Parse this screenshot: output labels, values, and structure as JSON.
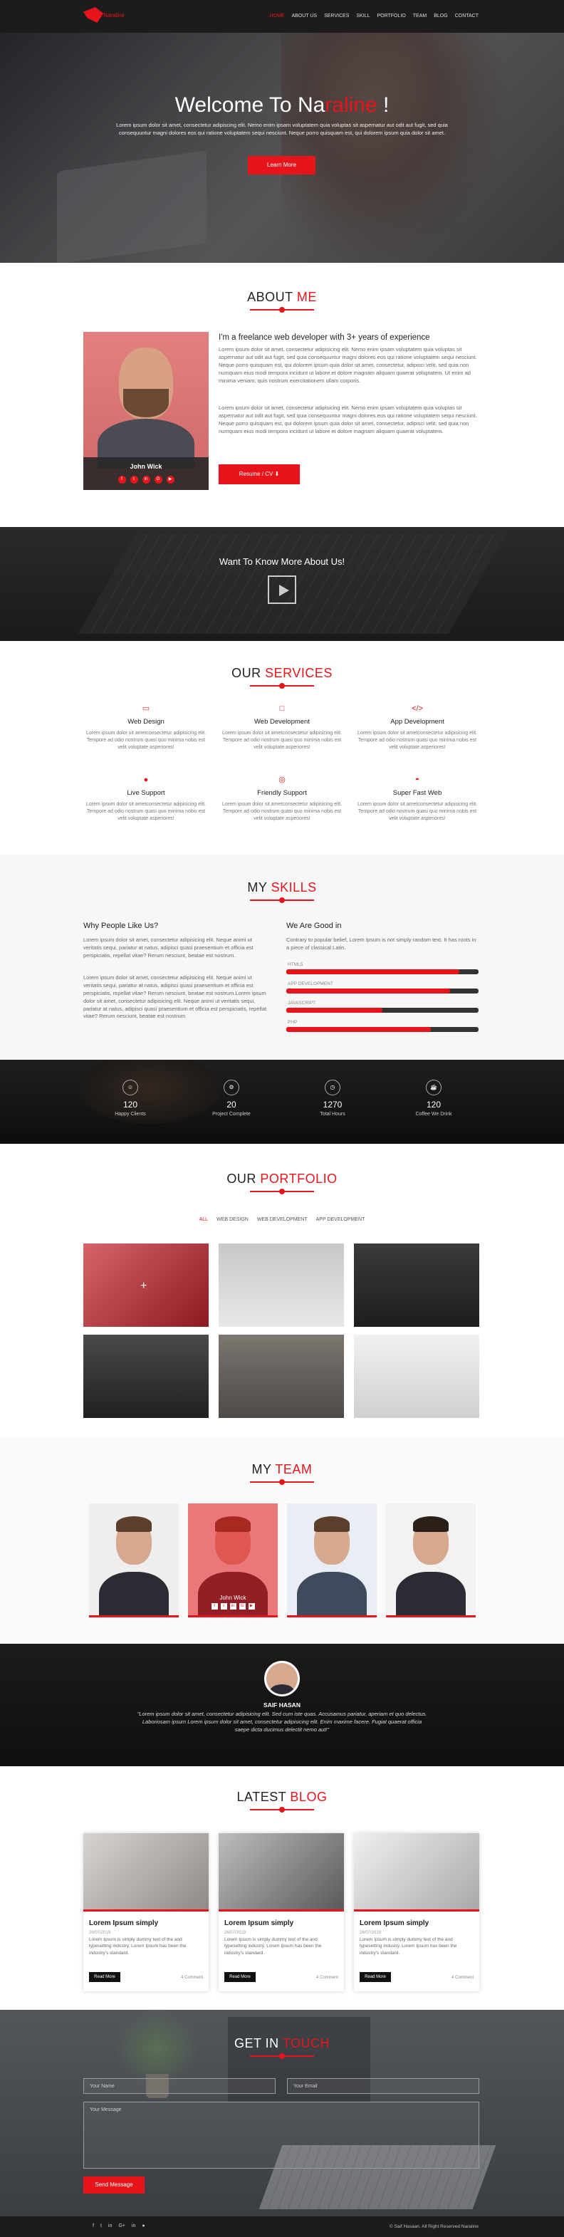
{
  "nav": {
    "logo_text": "Naraline",
    "items": [
      "HOME",
      "ABOUT US",
      "SERVICES",
      "SKILL",
      "PORTFOLIO",
      "TEAM",
      "BLOG",
      "CONTACT"
    ]
  },
  "hero": {
    "title_pre": "Welc",
    "title_mid1": "ome To Na",
    "title_red": "raline",
    "title_post": " !",
    "text": "Lorem ipsum dolor sit amet, consectetur adipiscing elit. Nemo enim ipsam voluptatem quia voluptas sit aspernatur aut odit aut fugit, sed quia consequuntur magni dolores eos qui ratione voluptatem sequi nesciunt. Neque porro quisquam est, qui dolorem ipsum quia dolor sit amet.",
    "button": "Learn More"
  },
  "about": {
    "title_a": "About",
    "title_b": "Me",
    "name": "John Wick",
    "heading": "I'm a freelance web developer with 3+ years of experience",
    "p1": "Lorem ipsum dolor sit amet, consectetur adipisicing elit. Nemo enim ipsam voluptatem quia voluptas sit aspernatur aut odit aut fugit, sed quia consequuntur magni dolores eos qui ratione voluptatem sequi nesciunt. Neque porro quisquam est, qui dolorem ipsum quia dolor sit amet, consectetur, adipisci velit, sed quia non numquam eius modi tempora incidunt ut labore et dolore magnam aliquam quaerat voluptatem. Ut enim ad minima veniam, quis nostrum exercitationem ullam corporis.",
    "p2": "Lorem ipsum dolor sit amet, consectetur adipisicing elit. Nemo enim ipsam voluptatem quia voluptas sit aspernatur aut odit aut fugit, sed quia consequuntur magni dolores eos qui ratione voluptatem sequi nesciunt. Neque porro quisquam est, qui dolorem ipsum quia dolor sit amet, consectetur, adipisci velit, sed quia non numquam eius modi tempora incidunt ut labore et dolore magnam aliquam quaerat voluptatem.",
    "resume": "Resume / CV"
  },
  "video": {
    "title": "Want To Know More About Us!"
  },
  "services": {
    "title_a": "Our",
    "title_b": "Services",
    "items": [
      {
        "icon": "monitor-icon",
        "glyph": "▭",
        "title": "Web Design",
        "desc": "Lorem ipsum dolor sit ametconsectetur adipisicing elit. Tempore ad odio nostrum quasi quo minima nobis est velit voluptate asperiores!"
      },
      {
        "icon": "laptop-icon",
        "glyph": "□",
        "title": "Web Development",
        "desc": "Lorem ipsum dolor sit ametconsectetur adipisicing elit. Tempore ad odio nostrum quasi quo minima nobis est velit voluptate asperiores!"
      },
      {
        "icon": "code-icon",
        "glyph": "</>",
        "title": "App Development",
        "desc": "Lorem ipsum dolor sit ametconsectetur adipisicing elit. Tempore ad odio nostrum quasi quo minima nobis est velit voluptate asperiores!"
      },
      {
        "icon": "chat-icon",
        "glyph": "●",
        "title": "Live Support",
        "desc": "Lorem ipsum dolor sit ametconsectetur adipisicing elit. Tempore ad odio nostrum quasi quo minima nobis est velit voluptate asperiores!"
      },
      {
        "icon": "lifebuoy-icon",
        "glyph": "◎",
        "title": "Friendly Support",
        "desc": "Lorem ipsum dolor sit ametconsectetur adipisicing elit. Tempore ad odio nostrum quasi quo minima nobis est velit voluptate asperiores!"
      },
      {
        "icon": "dashboard-icon",
        "glyph": "◓",
        "title": "Super Fast Web",
        "desc": "Lorem ipsum dolor sit ametconsectetur adipisicing elit. Tempore ad odio nostrum quasi quo minima nobis est velit voluptate asperiores!"
      }
    ]
  },
  "skills": {
    "title_a": "My",
    "title_b": "Skills",
    "left_heading": "Why People Like Us?",
    "left_p1": "Lorem ipsum dolor sit amet, consectetur adipisicing elit. Neque animi ut veritatis sequi, pariatur at natus, adipisci quasi praesentium et officia est perspiciatis, repellat vitae? Rerum nesciunt, beatae est nostrum.",
    "left_p2": "Lorem ipsum dolor sit amet, consectetur adipisicing elit. Neque animi ut veritatis sequi, pariatur at natus, adipisci quasi praesentium et officia est perspiciatis, repellat vitae? Rerum nesciunt, beatae est nostrum.Lorem ipsum dolor sit amet, consectetur adipisicing elit. Neque animi ut veritatis sequi, pariatur at natus, adipisci quasi praesentium et officia est perspiciatis, repellat vitae? Rerum nesciunt, beatae est nostrum.",
    "right_heading": "We Are Good in",
    "right_p": "Contrary to popular belief, Lorem Ipsum is not simply random text. It has roots in a piece of classical Latin.",
    "bars": [
      {
        "label": "HTML5",
        "value": 0.9,
        "pct": "90%"
      },
      {
        "label": "APP DEVELOPMENT",
        "value": 0.85,
        "pct": "85%"
      },
      {
        "label": "JAVASCRIPT",
        "value": 0.5,
        "pct": "50%"
      },
      {
        "label": "PHP",
        "value": 0.75,
        "pct": "75%"
      }
    ]
  },
  "counters": [
    {
      "icon": "smile-icon",
      "glyph": "☺",
      "num": "120",
      "label": "Happy Clients"
    },
    {
      "icon": "project-icon",
      "glyph": "⚙",
      "num": "20",
      "label": "Project Complete"
    },
    {
      "icon": "clock-icon",
      "glyph": "◷",
      "num": "1270",
      "label": "Total Hours"
    },
    {
      "icon": "coffee-icon",
      "glyph": "☕",
      "num": "120",
      "label": "Coffee We Drink"
    }
  ],
  "portfolio": {
    "title_a": "Our",
    "title_b": "Portfolio",
    "filters": [
      "ALL",
      "WEB DESIGN",
      "WEB DEVELOPMENT",
      "APP DEVELOPMENT"
    ],
    "colors": [
      "#a8262c",
      "#d8d8d6",
      "#2c2c2e",
      "#3a3a3c",
      "#6c6a68",
      "#e6e6e4"
    ]
  },
  "team": {
    "title_a": "My",
    "title_b": "Team",
    "highlight_name": "John Wick"
  },
  "testimonial": {
    "name": "SAIF HASAN",
    "quote": "\"Lorem ipsum dolor sit amet, consectetur adipisicing elit. Sed cum iste quas. Accusamus pariatur, aperiam et quo delectus. Laboriosam ipsum Lorem ipsum dolor sit amet, consectetur adipisicing elit. Enim maxime facere. Fugiat quaerat officia saepe dicta ducimus delectit nemo aut!\""
  },
  "blog": {
    "title_a": "Latest",
    "title_b": "Blog",
    "posts": [
      {
        "title": "Lorem Ipsum simply",
        "date": "26/07/2019",
        "body": "Lorem Ipsum is simply dummy text of the and typesetting industry. Lorem Ipsum has been the industry's standard.",
        "btn": "Read More",
        "comments": "4 Comment"
      },
      {
        "title": "Lorem Ipsum simply",
        "date": "26/07/2019",
        "body": "Lorem Ipsum is simply dummy text of the and typesetting industry. Lorem Ipsum has been the industry's standard.",
        "btn": "Read More",
        "comments": "4 Comment"
      },
      {
        "title": "Lorem Ipsum simply",
        "date": "26/07/2019",
        "body": "Lorem Ipsum is simply dummy text of the and typesetting industry. Lorem Ipsum has been the industry's standard.",
        "btn": "Read More",
        "comments": "4 Comment"
      }
    ]
  },
  "contact": {
    "title_a": "Get In",
    "title_b": "Touch",
    "name_ph": "Your Name",
    "email_ph": "Your Email",
    "msg_ph": "Your Message",
    "send": "Send Message"
  },
  "footer": {
    "socials": [
      "f",
      "t",
      "in",
      "G+",
      "in",
      "●"
    ],
    "copy": "© Saif Hasaan. All Right Reserved Naraline"
  },
  "accent_color": "#e7151b"
}
